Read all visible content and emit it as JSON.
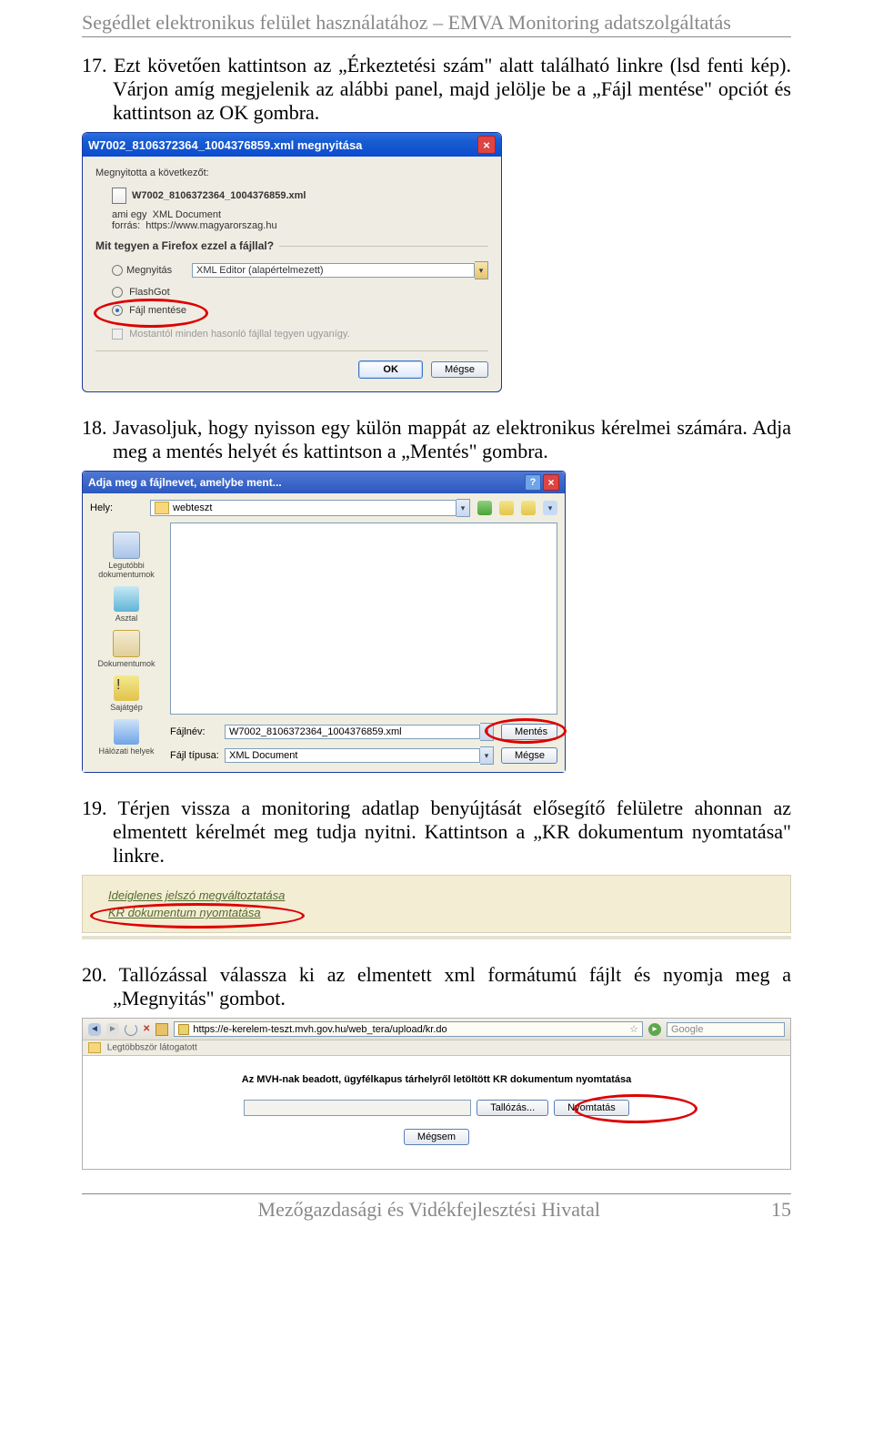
{
  "header": "Segédlet elektronikus felület használatához – EMVA Monitoring adatszolgáltatás",
  "instructions": {
    "i17": "17. Ezt követően kattintson az „Érkeztetési szám\" alatt található linkre (lsd fenti kép). Várjon amíg megjelenik az alábbi panel, majd jelölje be a „Fájl mentése\" opciót és kattintson az OK gombra.",
    "i18": "18. Javasoljuk, hogy nyisson egy külön mappát az elektronikus kérelmei számára. Adja meg a mentés helyét és kattintson a „Mentés\" gombra.",
    "i19": "19. Térjen vissza a monitoring adatlap benyújtását elősegítő felületre ahonnan az elmentett kérelmét meg tudja nyitni. Kattintson a „KR dokumentum nyomtatása\" linkre.",
    "i20": "20. Tallózással válassza ki az elmentett xml formátumú fájlt és nyomja meg a „Megnyitás\" gombot."
  },
  "fig1": {
    "title": "W7002_8106372364_1004376859.xml megnyitása",
    "header": "Megnyitotta a következőt:",
    "filename": "W7002_8106372364_1004376859.xml",
    "type_line": "ami egy  XML Document",
    "source_line": "forrás:  https://www.magyarorszag.hu",
    "question": "Mit tegyen a Firefox ezzel a fájllal?",
    "opt_open": "Megnyitás",
    "opt_open_val": "XML Editor (alapértelmezett)",
    "opt_flash": "FlashGot",
    "opt_save": "Fájl mentése",
    "remember": "Mostantól minden hasonló fájllal tegyen ugyanígy.",
    "ok": "OK",
    "cancel": "Mégse"
  },
  "fig2": {
    "title": "Adja meg a fájlnevet, amelybe ment...",
    "loc_label": "Hely:",
    "loc_val": "webteszt",
    "side": {
      "recent": "Legutóbbi dokumentumok",
      "desktop": "Asztal",
      "docs": "Dokumentumok",
      "mycomp": "Sajátgép",
      "network": "Hálózati helyek"
    },
    "fname_lbl": "Fájlnév:",
    "fname_val": "W7002_8106372364_1004376859.xml",
    "ftype_lbl": "Fájl típusa:",
    "ftype_val": "XML Document",
    "save": "Mentés",
    "cancel": "Mégse"
  },
  "fig3": {
    "pwd": "Ideiglenes jelszó megváltoztatása",
    "print": "KR dokumentum nyomtatása"
  },
  "fig4": {
    "url": "https://e-kerelem-teszt.mvh.gov.hu/web_tera/upload/kr.do",
    "search_placeholder": "Google",
    "bookmarks": "Legtöbbször látogatott",
    "heading": "Az MVH-nak beadott, ügyfélkapus tárhelyről letöltött KR dokumentum nyomtatása",
    "browse": "Tallózás...",
    "print": "Nyomtatás",
    "cancel": "Mégsem"
  },
  "footer": {
    "org": "Mezőgazdasági és Vidékfejlesztési Hivatal",
    "page": "15"
  }
}
